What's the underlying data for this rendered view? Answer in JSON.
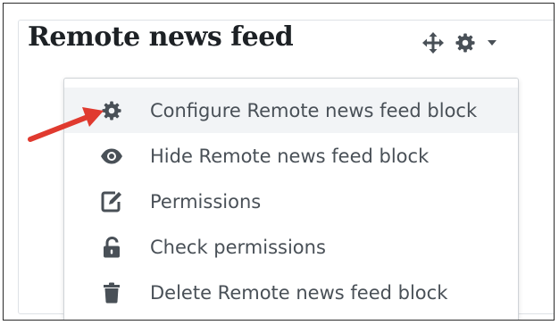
{
  "block": {
    "title": "Remote news feed"
  },
  "controls": {
    "move_icon": "move-arrows-icon",
    "settings_icon": "gear-icon",
    "caret_icon": "caret-down-icon"
  },
  "menu": {
    "items": [
      {
        "label": "Configure Remote news feed block",
        "icon": "gear-icon",
        "highlighted": true
      },
      {
        "label": "Hide Remote news feed block",
        "icon": "eye-icon",
        "highlighted": false
      },
      {
        "label": "Permissions",
        "icon": "edit-icon",
        "highlighted": false
      },
      {
        "label": "Check permissions",
        "icon": "unlock-icon",
        "highlighted": false
      },
      {
        "label": "Delete Remote news feed block",
        "icon": "trash-icon",
        "highlighted": false
      }
    ]
  },
  "annotation": {
    "type": "red-arrow",
    "points_to": "Configure Remote news feed block",
    "color": "#e03a2f"
  },
  "colors": {
    "icon": "#495057",
    "text": "#495057",
    "title": "#1d2125",
    "highlight": "#f2f4f6"
  }
}
